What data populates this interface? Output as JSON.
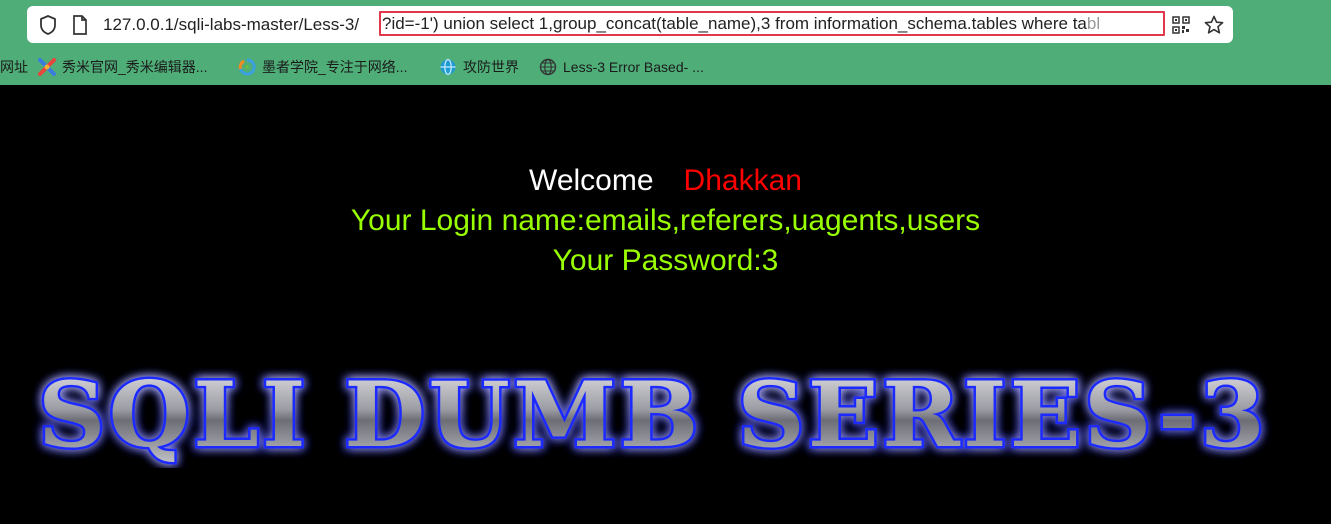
{
  "browser": {
    "url_prefix": "127.0.0.1/sqli-labs-master/Less-3/",
    "url_query": "?id=-1') union select 1,group_concat(table_name),3 from information_schema.tables where ta",
    "url_query_faded": "bl",
    "bookmarks": [
      {
        "label": "网址",
        "icon": "none"
      },
      {
        "label": "秀米官网_秀米编辑器...",
        "icon": "xiumi-icon"
      },
      {
        "label": "墨者学院_专注于网络...",
        "icon": "mozhe-icon"
      },
      {
        "label": "攻防世界",
        "icon": "adworld-icon"
      },
      {
        "label": "Less-3 Error Based- ...",
        "icon": "globe-icon"
      }
    ]
  },
  "page": {
    "welcome": "Welcome",
    "user": "Dhakkan",
    "login_line": "Your Login name:emails,referers,uagents,users",
    "password_line": "Your Password:3",
    "banner_text": "SQLI DUMB SERIES-3"
  },
  "colors": {
    "chrome_bg": "#4fae78",
    "highlight_border": "#e0394e",
    "welcome": "#ffffff",
    "user": "#ff0000",
    "result_text": "#99ff00",
    "banner_glow": "#1a2cff"
  }
}
